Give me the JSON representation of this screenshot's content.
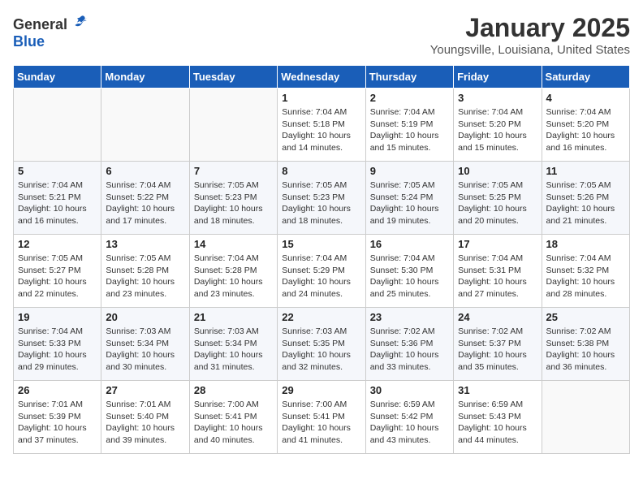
{
  "logo": {
    "general": "General",
    "blue": "Blue"
  },
  "header": {
    "month": "January 2025",
    "location": "Youngsville, Louisiana, United States"
  },
  "weekdays": [
    "Sunday",
    "Monday",
    "Tuesday",
    "Wednesday",
    "Thursday",
    "Friday",
    "Saturday"
  ],
  "weeks": [
    [
      {
        "day": "",
        "sunrise": "",
        "sunset": "",
        "daylight": ""
      },
      {
        "day": "",
        "sunrise": "",
        "sunset": "",
        "daylight": ""
      },
      {
        "day": "",
        "sunrise": "",
        "sunset": "",
        "daylight": ""
      },
      {
        "day": "1",
        "sunrise": "Sunrise: 7:04 AM",
        "sunset": "Sunset: 5:18 PM",
        "daylight": "Daylight: 10 hours and 14 minutes."
      },
      {
        "day": "2",
        "sunrise": "Sunrise: 7:04 AM",
        "sunset": "Sunset: 5:19 PM",
        "daylight": "Daylight: 10 hours and 15 minutes."
      },
      {
        "day": "3",
        "sunrise": "Sunrise: 7:04 AM",
        "sunset": "Sunset: 5:20 PM",
        "daylight": "Daylight: 10 hours and 15 minutes."
      },
      {
        "day": "4",
        "sunrise": "Sunrise: 7:04 AM",
        "sunset": "Sunset: 5:20 PM",
        "daylight": "Daylight: 10 hours and 16 minutes."
      }
    ],
    [
      {
        "day": "5",
        "sunrise": "Sunrise: 7:04 AM",
        "sunset": "Sunset: 5:21 PM",
        "daylight": "Daylight: 10 hours and 16 minutes."
      },
      {
        "day": "6",
        "sunrise": "Sunrise: 7:04 AM",
        "sunset": "Sunset: 5:22 PM",
        "daylight": "Daylight: 10 hours and 17 minutes."
      },
      {
        "day": "7",
        "sunrise": "Sunrise: 7:05 AM",
        "sunset": "Sunset: 5:23 PM",
        "daylight": "Daylight: 10 hours and 18 minutes."
      },
      {
        "day": "8",
        "sunrise": "Sunrise: 7:05 AM",
        "sunset": "Sunset: 5:23 PM",
        "daylight": "Daylight: 10 hours and 18 minutes."
      },
      {
        "day": "9",
        "sunrise": "Sunrise: 7:05 AM",
        "sunset": "Sunset: 5:24 PM",
        "daylight": "Daylight: 10 hours and 19 minutes."
      },
      {
        "day": "10",
        "sunrise": "Sunrise: 7:05 AM",
        "sunset": "Sunset: 5:25 PM",
        "daylight": "Daylight: 10 hours and 20 minutes."
      },
      {
        "day": "11",
        "sunrise": "Sunrise: 7:05 AM",
        "sunset": "Sunset: 5:26 PM",
        "daylight": "Daylight: 10 hours and 21 minutes."
      }
    ],
    [
      {
        "day": "12",
        "sunrise": "Sunrise: 7:05 AM",
        "sunset": "Sunset: 5:27 PM",
        "daylight": "Daylight: 10 hours and 22 minutes."
      },
      {
        "day": "13",
        "sunrise": "Sunrise: 7:05 AM",
        "sunset": "Sunset: 5:28 PM",
        "daylight": "Daylight: 10 hours and 23 minutes."
      },
      {
        "day": "14",
        "sunrise": "Sunrise: 7:04 AM",
        "sunset": "Sunset: 5:28 PM",
        "daylight": "Daylight: 10 hours and 23 minutes."
      },
      {
        "day": "15",
        "sunrise": "Sunrise: 7:04 AM",
        "sunset": "Sunset: 5:29 PM",
        "daylight": "Daylight: 10 hours and 24 minutes."
      },
      {
        "day": "16",
        "sunrise": "Sunrise: 7:04 AM",
        "sunset": "Sunset: 5:30 PM",
        "daylight": "Daylight: 10 hours and 25 minutes."
      },
      {
        "day": "17",
        "sunrise": "Sunrise: 7:04 AM",
        "sunset": "Sunset: 5:31 PM",
        "daylight": "Daylight: 10 hours and 27 minutes."
      },
      {
        "day": "18",
        "sunrise": "Sunrise: 7:04 AM",
        "sunset": "Sunset: 5:32 PM",
        "daylight": "Daylight: 10 hours and 28 minutes."
      }
    ],
    [
      {
        "day": "19",
        "sunrise": "Sunrise: 7:04 AM",
        "sunset": "Sunset: 5:33 PM",
        "daylight": "Daylight: 10 hours and 29 minutes."
      },
      {
        "day": "20",
        "sunrise": "Sunrise: 7:03 AM",
        "sunset": "Sunset: 5:34 PM",
        "daylight": "Daylight: 10 hours and 30 minutes."
      },
      {
        "day": "21",
        "sunrise": "Sunrise: 7:03 AM",
        "sunset": "Sunset: 5:34 PM",
        "daylight": "Daylight: 10 hours and 31 minutes."
      },
      {
        "day": "22",
        "sunrise": "Sunrise: 7:03 AM",
        "sunset": "Sunset: 5:35 PM",
        "daylight": "Daylight: 10 hours and 32 minutes."
      },
      {
        "day": "23",
        "sunrise": "Sunrise: 7:02 AM",
        "sunset": "Sunset: 5:36 PM",
        "daylight": "Daylight: 10 hours and 33 minutes."
      },
      {
        "day": "24",
        "sunrise": "Sunrise: 7:02 AM",
        "sunset": "Sunset: 5:37 PM",
        "daylight": "Daylight: 10 hours and 35 minutes."
      },
      {
        "day": "25",
        "sunrise": "Sunrise: 7:02 AM",
        "sunset": "Sunset: 5:38 PM",
        "daylight": "Daylight: 10 hours and 36 minutes."
      }
    ],
    [
      {
        "day": "26",
        "sunrise": "Sunrise: 7:01 AM",
        "sunset": "Sunset: 5:39 PM",
        "daylight": "Daylight: 10 hours and 37 minutes."
      },
      {
        "day": "27",
        "sunrise": "Sunrise: 7:01 AM",
        "sunset": "Sunset: 5:40 PM",
        "daylight": "Daylight: 10 hours and 39 minutes."
      },
      {
        "day": "28",
        "sunrise": "Sunrise: 7:00 AM",
        "sunset": "Sunset: 5:41 PM",
        "daylight": "Daylight: 10 hours and 40 minutes."
      },
      {
        "day": "29",
        "sunrise": "Sunrise: 7:00 AM",
        "sunset": "Sunset: 5:41 PM",
        "daylight": "Daylight: 10 hours and 41 minutes."
      },
      {
        "day": "30",
        "sunrise": "Sunrise: 6:59 AM",
        "sunset": "Sunset: 5:42 PM",
        "daylight": "Daylight: 10 hours and 43 minutes."
      },
      {
        "day": "31",
        "sunrise": "Sunrise: 6:59 AM",
        "sunset": "Sunset: 5:43 PM",
        "daylight": "Daylight: 10 hours and 44 minutes."
      },
      {
        "day": "",
        "sunrise": "",
        "sunset": "",
        "daylight": ""
      }
    ]
  ]
}
